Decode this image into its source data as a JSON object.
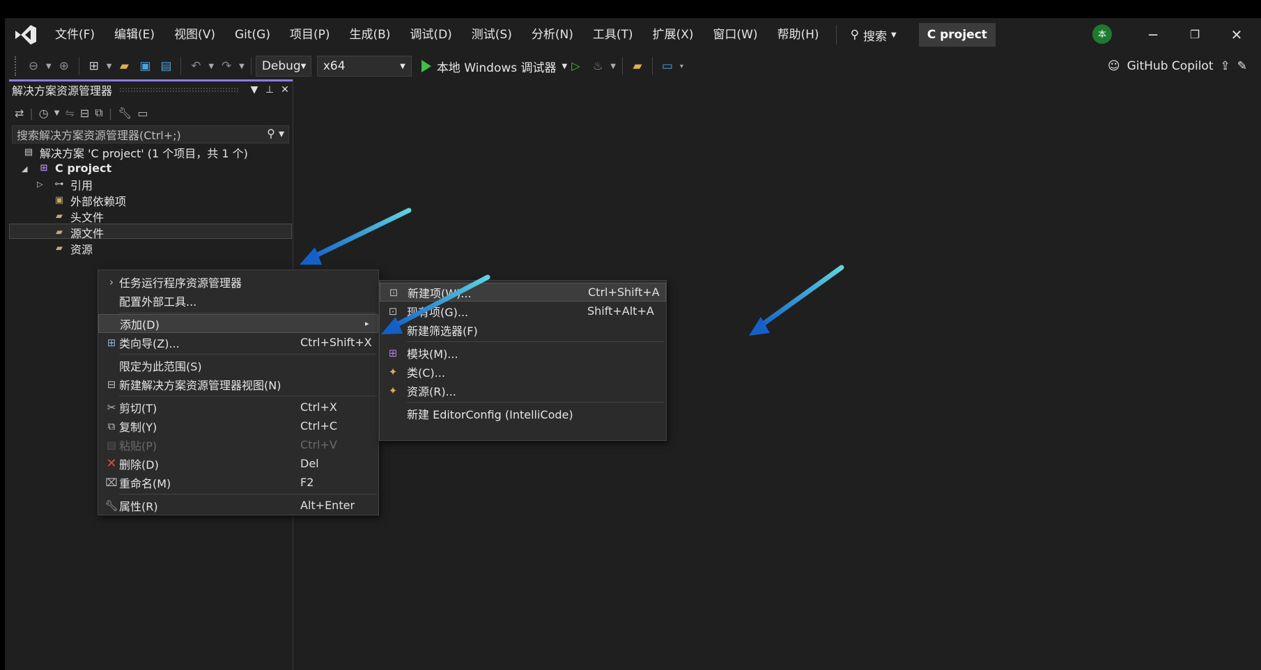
{
  "menubar": {
    "items": [
      "文件(F)",
      "编辑(E)",
      "视图(V)",
      "Git(G)",
      "项目(P)",
      "生成(B)",
      "调试(D)",
      "测试(S)",
      "分析(N)",
      "工具(T)",
      "扩展(X)",
      "窗口(W)",
      "帮助(H)"
    ],
    "search_label": "搜索",
    "project_title": "C project",
    "avatar_text": "本"
  },
  "toolbar": {
    "config": "Debug",
    "platform": "x64",
    "run_label": "本地 Windows 调试器",
    "copilot_label": "GitHub Copilot"
  },
  "solution_explorer": {
    "title": "解决方案资源管理器",
    "search_placeholder": "搜索解决方案资源管理器(Ctrl+;)",
    "tree": {
      "solution": "解决方案 'C project' (1 个项目，共 1 个)",
      "project": "C project",
      "references": "引用",
      "external": "外部依赖项",
      "headers": "头文件",
      "sources": "源文件",
      "resources": "资源"
    }
  },
  "context_menu": {
    "task_runner": "任务运行程序资源管理器",
    "external_tools": "配置外部工具...",
    "add": "添加(D)",
    "class_wizard": "类向导(Z)...",
    "class_wizard_shortcut": "Ctrl+Shift+X",
    "scope": "限定为此范围(S)",
    "new_view": "新建解决方案资源管理器视图(N)",
    "cut": "剪切(T)",
    "cut_shortcut": "Ctrl+X",
    "copy": "复制(Y)",
    "copy_shortcut": "Ctrl+C",
    "paste": "粘贴(P)",
    "paste_shortcut": "Ctrl+V",
    "delete": "删除(D)",
    "delete_shortcut": "Del",
    "rename": "重命名(M)",
    "rename_shortcut": "F2",
    "properties": "属性(R)",
    "properties_shortcut": "Alt+Enter"
  },
  "add_submenu": {
    "new_item": "新建项(W)...",
    "new_item_shortcut": "Ctrl+Shift+A",
    "existing_item": "现有项(G)...",
    "existing_item_shortcut": "Shift+Alt+A",
    "new_filter": "新建筛选器(F)",
    "module": "模块(M)...",
    "class": "类(C)...",
    "resource": "资源(R)...",
    "editorconfig": "新建 EditorConfig (IntelliCode)"
  },
  "colors": {
    "background": "#1f1f1f",
    "menu_bg": "#2b2b2b",
    "accent_purple": "#8f7ce0",
    "run_green": "#3fbf4a",
    "arrow_start": "#5fd4e0",
    "arrow_end": "#1560c8"
  }
}
